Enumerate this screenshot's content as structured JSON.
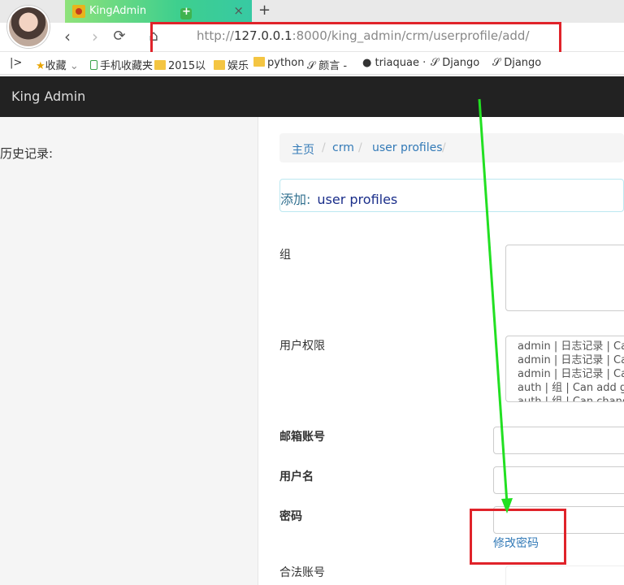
{
  "browser": {
    "tab_title": "KingAdmin",
    "tab_close": "×",
    "new_tab": "+",
    "url_prefix": "http://",
    "url_host": "127.0.0.1",
    "url_rest": ":8000/king_admin/crm/userprofile/add/",
    "bookmarks": [
      "收藏",
      "手机收藏夹",
      "2015以",
      "娱乐",
      "python",
      "颜言 -",
      "triaquae ·",
      "Django",
      "Django"
    ]
  },
  "app": {
    "brand": "King Admin",
    "history_label": "历史记录:"
  },
  "breadcrumb": {
    "items": [
      "主页",
      "crm",
      "user profiles"
    ],
    "separator": "/"
  },
  "panel": {
    "prefix": "添加:",
    "model": "user profiles"
  },
  "form": {
    "groups_label": "组",
    "permissions_label": "用户权限",
    "permissions_options": [
      "admin | 日志记录 | Can add log entry",
      "admin | 日志记录 | Can change log entry",
      "admin | 日志记录 | Can delete log entry",
      "auth | 组 | Can add group",
      "auth | 组 | Can change group"
    ],
    "email_label": "邮箱账号",
    "username_label": "用户名",
    "password_label": "密码",
    "change_password_link": "修改密码",
    "valid_label": "合法账号"
  },
  "colors": {
    "annotation_red": "#e0232a",
    "annotation_green": "#22e022",
    "header_dark": "#222222",
    "link_blue": "#337ab7"
  }
}
